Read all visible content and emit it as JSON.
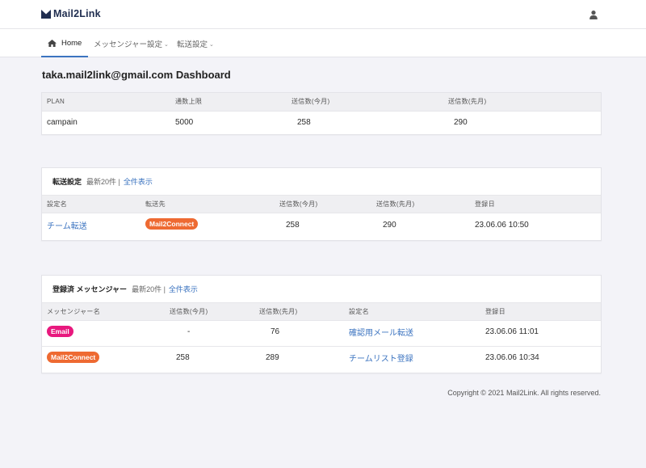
{
  "app": {
    "logo_text": "Mail2Link"
  },
  "nav": {
    "home": "Home",
    "messenger_settings": "メッセンジャー設定",
    "forward_settings": "転送設定"
  },
  "page_title": "taka.mail2link@gmail.com Dashboard",
  "plan_table": {
    "headers": [
      "PLAN",
      "通数上限",
      "送信数(今月)",
      "送信数(先月)"
    ],
    "row": [
      "campain",
      "5000",
      "258",
      "290"
    ]
  },
  "forward_card": {
    "title": "転送設定",
    "subtitle": "最新20件 |",
    "show_all": "全件表示",
    "headers": [
      "設定名",
      "転送先",
      "送信数(今月)",
      "送信数(先月)",
      "登録日"
    ],
    "rows": [
      {
        "name": "チーム転送",
        "dest": "Mail2Connect",
        "dest_color": "#ee6a32",
        "this_month": "258",
        "last_month": "290",
        "date": "23.06.06 10:50"
      }
    ]
  },
  "messenger_card": {
    "title": "登録済 メッセンジャー",
    "subtitle": "最新20件 |",
    "show_all": "全件表示",
    "headers": [
      "メッセンジャー名",
      "送信数(今月)",
      "送信数(先月)",
      "設定名",
      "登録日"
    ],
    "rows": [
      {
        "messenger": "Email",
        "color": "#e8197e",
        "this_month": "-",
        "last_month": "76",
        "setting": "確認用メール転送",
        "date": "23.06.06 11:01"
      },
      {
        "messenger": "Mail2Connect",
        "color": "#ee6a32",
        "this_month": "258",
        "last_month": "289",
        "setting": "チームリスト登録",
        "date": "23.06.06 10:34"
      }
    ]
  },
  "footer": "Copyright © 2021 Mail2Link. All rights reserved.",
  "colors": {
    "accent": "#3c74c0",
    "brand_dark": "#1f2d4f",
    "email_badge": "#e8197e",
    "connect_badge": "#ee6a32"
  }
}
